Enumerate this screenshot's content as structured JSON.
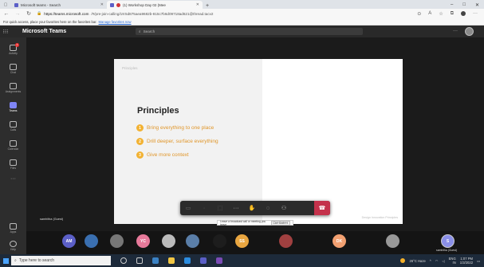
{
  "browser": {
    "tabs": [
      {
        "label": "Microsoft teams - Search",
        "favicon": "bing-icon"
      },
      {
        "label": "(1) Workshop Day 02 (Mee",
        "favicon": "teams-recording-icon",
        "active": true
      }
    ],
    "new_tab": "+",
    "window_controls": [
      "–",
      "□",
      "✕"
    ],
    "url_host": "https://teams.microsoft.com",
    "url_path": "/#/pre-join-calling/19:5d875aea9682b-815c7b6d09718ad621@thread.tacv2",
    "favorites_text": "For quick access, place your favorites here on the favorites bar.",
    "favorites_link": "Manage favorites now"
  },
  "teams": {
    "app_name": "Microsoft Teams",
    "search_placeholder": "Search",
    "more": "···"
  },
  "rail": [
    {
      "label": "Activity",
      "icon": "bell-icon",
      "badge": "1"
    },
    {
      "label": "Chat",
      "icon": "chat-icon"
    },
    {
      "label": "Assignments",
      "icon": "backpack-icon"
    },
    {
      "label": "Teams",
      "icon": "teams-icon",
      "active": true
    },
    {
      "label": "Calls",
      "icon": "phone-icon"
    },
    {
      "label": "Calendar",
      "icon": "calendar-icon"
    },
    {
      "label": "Files",
      "icon": "file-icon"
    }
  ],
  "rail_bottom": [
    {
      "label": "Apps",
      "icon": "apps-icon"
    },
    {
      "label": "Help",
      "icon": "help-icon"
    }
  ],
  "slide": {
    "tag": "Principles",
    "title": "Principles",
    "bullets": [
      {
        "num": "1",
        "text": "Bring everything to one place"
      },
      {
        "num": "2",
        "text": "Drill deeper, surface everything"
      },
      {
        "num": "3",
        "text": "Give more context"
      }
    ],
    "footer": "Design Innovation Principles"
  },
  "presenter_name": "samhitha (Guest)",
  "toolbar": {
    "tooltip_text": "Leave a broadcast call or meeting you leave",
    "tooltip_key": "Ctrl+Shift+H"
  },
  "participants": [
    {
      "initials": "AM",
      "color": "#5b5fc7"
    },
    {
      "initials": "",
      "color": "#3a6fb0",
      "icon": "photo"
    },
    {
      "initials": "",
      "color": "#777",
      "icon": "photo"
    },
    {
      "initials": "YC",
      "color": "#e7799a"
    },
    {
      "initials": "",
      "color": "#bbb",
      "icon": "photo"
    },
    {
      "initials": "",
      "color": "#5a7ea8",
      "icon": "photo"
    },
    {
      "initials": "",
      "color": "#1d1d1d",
      "icon": "photo"
    },
    {
      "initials": "SS",
      "color": "#e9a640"
    },
    {
      "initials": "",
      "color": "#a04040",
      "icon": "photo"
    },
    {
      "initials": "DK",
      "color": "#f2a071"
    },
    {
      "initials": "",
      "color": "#999",
      "icon": "photo"
    },
    {
      "initials": "S",
      "color": "#8a8fe8",
      "self": true,
      "name": "samhitha (Guest)"
    }
  ],
  "taskbar": {
    "search_placeholder": "Type here to search",
    "weather": "26°C Haze",
    "lang": "ENG",
    "region": "IN",
    "time": "1:07 PM",
    "date": "1/3/2022"
  }
}
